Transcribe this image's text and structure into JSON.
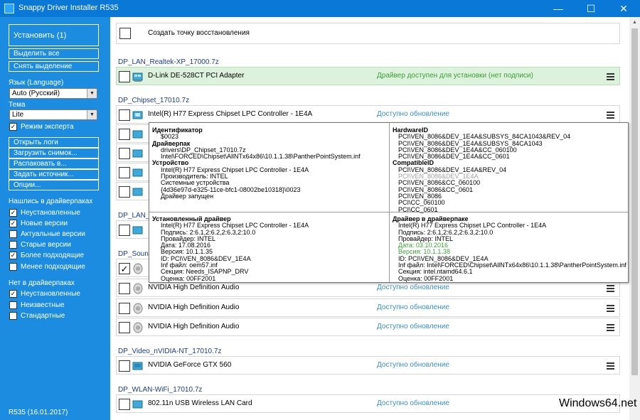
{
  "window": {
    "title": "Snappy Driver Installer R535",
    "minimize": "—",
    "maximize": "☐",
    "close": "✕"
  },
  "sidebar": {
    "install_label": "Установить (1)",
    "select_all_label": "Выделить все",
    "deselect_label": "Снять выделение",
    "language_label": "Язык (Language)",
    "language_value": "Auto (Русский)",
    "theme_label": "Тема",
    "theme_value": "Lite",
    "expert_mode_label": "Режим эксперта",
    "expert_mode_checked": true,
    "open_logs_label": "Открыть логи",
    "load_snapshot_label": "Загрузить снимок...",
    "extract_label": "Распаковать в...",
    "set_source_label": "Задать источник...",
    "options_label": "Опции...",
    "found_header": "Нашлись в драйверпаках",
    "found_filters": [
      {
        "label": "Неустановленные",
        "checked": true
      },
      {
        "label": "Новые версии",
        "checked": true
      },
      {
        "label": "Актуальные версии",
        "checked": false
      },
      {
        "label": "Старые версии",
        "checked": false
      },
      {
        "label": "Более подходящие",
        "checked": true
      },
      {
        "label": "Менее подходящие",
        "checked": false
      }
    ],
    "notfound_header": "Нет в драйверпаках",
    "notfound_filters": [
      {
        "label": "Неустановленные",
        "checked": true
      },
      {
        "label": "Неизвестные",
        "checked": false
      },
      {
        "label": "Стандартные",
        "checked": false
      }
    ],
    "version": "R535 (16.01.2017)"
  },
  "main": {
    "restore_point_label": "Создать точку восстановления",
    "groups": [
      "DP_LAN_Realtek-XP_17000.7z",
      "DP_Chipset_17010.7z",
      "DP_LAN_C",
      "DP_Sound",
      "DP_Video_nVIDIA-NT_17010.7z",
      "DP_WLAN-WiFi_17010.7z"
    ],
    "rows": [
      {
        "name": "D-Link DE-528CT PCI Adapter",
        "status": "Драйвер доступен для установки (нет подписи)",
        "checked": false
      },
      {
        "name": "Intel(R) H77 Express Chipset LPC Controller - 1E4A",
        "status": "Доступно обновление",
        "checked": false
      },
      {
        "name": "",
        "status": "",
        "checked": false
      },
      {
        "name": "",
        "status": "",
        "checked": false
      },
      {
        "name": "",
        "status": "",
        "checked": false
      },
      {
        "name": "",
        "status": "",
        "checked": false
      },
      {
        "name": "",
        "status": "",
        "checked": false
      },
      {
        "name": "",
        "status": "",
        "checked": true
      },
      {
        "name": "NVIDIA High Definition Audio",
        "status": "Доступно обновление",
        "checked": false
      },
      {
        "name": "NVIDIA High Definition Audio",
        "status": "Доступно обновление",
        "checked": false
      },
      {
        "name": "NVIDIA High Definition Audio",
        "status": "Доступно обновление",
        "checked": false
      },
      {
        "name": "NVIDIA GeForce GTX 560",
        "status": "Доступно обновление",
        "checked": false
      },
      {
        "name": "802.11n USB Wireless LAN Card",
        "status": "Доступно обновление",
        "checked": false
      }
    ]
  },
  "popup": {
    "left_top": {
      "id_header": "Идентификатор",
      "id_value": "$0023",
      "pack_header": "Драйверпак",
      "pack_lines": [
        "drivers\\DP_Chipset_17010.7z",
        "Intel\\FORCED\\Chipset\\AllNTx64x86\\10.1.1.38\\PantherPointSystem.inf"
      ],
      "device_header": "Устройство",
      "device_lines": [
        "Intel(R) H77 Express Chipset LPC Controller - 1E4A",
        "Производитель: INTEL",
        "Системные устройства",
        "{4d36e97d-e325-11ce-bfc1-08002be10318}\\0023",
        "Драйвер запущен"
      ]
    },
    "right_top": {
      "hwid_header": "HardwareID",
      "hwid_lines": [
        "PCI\\VEN_8086&DEV_1E4A&SUBSYS_84CA1043&REV_04",
        "PCI\\VEN_8086&DEV_1E4A&SUBSYS_84CA1043",
        "PCI\\VEN_8086&DEV_1E4A&CC_060100",
        "PCI\\VEN_8086&DEV_1E4A&CC_0601"
      ],
      "compat_header": "CompatibleID",
      "compat_lines": [
        "PCI\\VEN_8086&DEV_1E4A&REV_04",
        "PCI\\VEN_8086&DEV_1E4A",
        "PCI\\VEN_8086&CC_060100",
        "PCI\\VEN_8086&CC_0601",
        "PCI\\VEN_8086",
        "PCI\\CC_060100",
        "PCI\\CC_0601"
      ]
    },
    "left_bottom": {
      "header": "Установленный драйвер",
      "lines": [
        "Intel(R) H77 Express Chipset LPC Controller - 1E4A",
        "Подпись: 2:6.1,2:6.2,2:6.3,2:10.0",
        "Провайдер: INTEL",
        "Дата: 17.08.2016",
        "Версия: 10.1.1.35",
        "ID: PCI\\VEN_8086&DEV_1E4A",
        "Inf файл: oem57.inf",
        "Секция: Needs_ISAPNP_DRV",
        "Оценка: 00FF2001"
      ]
    },
    "right_bottom": {
      "header": "Драйвер в драйверпаке",
      "lines": [
        "Intel(R) H77 Express Chipset LPC Controller - 1E4A",
        "Подпись: 2:6.1,2:6.2,2:6.3,2:10.0",
        "Провайдер: INTEL",
        "Дата: 03.10.2016",
        "Версия: 10.1.1.38",
        "ID: PCI\\VEN_8086&DEV_1E4A",
        "Inf файл: Intel\\FORCED\\Chipset\\AllNTx64x86\\10.1.1.38\\PantherPointSystem.inf",
        "Секция: intel.ntamd64.6.1",
        "Оценка: 00FF2001"
      ]
    }
  },
  "watermark": "Windows64.net",
  "colors": {
    "sidebar_bg": "#1c8ce0",
    "titlebar_bg": "#0a78d7",
    "status_green": "#3aa035",
    "status_blue": "#3a8fc8",
    "group_blue": "#1b3c8a",
    "row_highlight": "#ddf2dd"
  }
}
